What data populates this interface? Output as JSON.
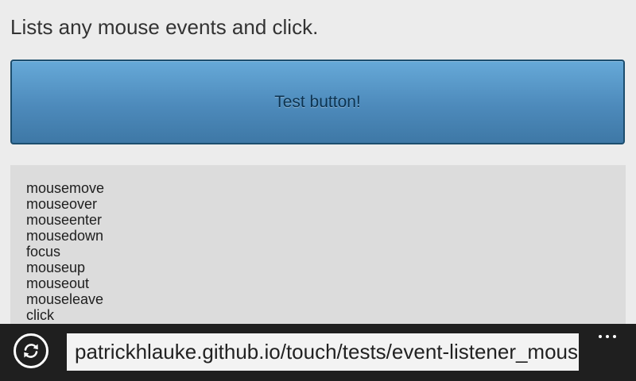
{
  "page": {
    "description": "Lists any mouse events and click."
  },
  "test_button": {
    "label": "Test button!"
  },
  "event_log": {
    "items": [
      "mousemove",
      "mouseover",
      "mouseenter",
      "mousedown",
      "focus",
      "mouseup",
      "mouseout",
      "mouseleave",
      "click"
    ]
  },
  "browser_bar": {
    "refresh_icon": "refresh-icon",
    "address": "patrickhlauke.github.io/touch/tests/event-listener_mouse",
    "more_icon": "more-icon"
  },
  "colors": {
    "page_background": "#ececec",
    "button_top": "#66a9d8",
    "button_bottom": "#3e78a6",
    "log_background": "#dcdcdc",
    "app_bar_background": "#1f1f1f"
  }
}
